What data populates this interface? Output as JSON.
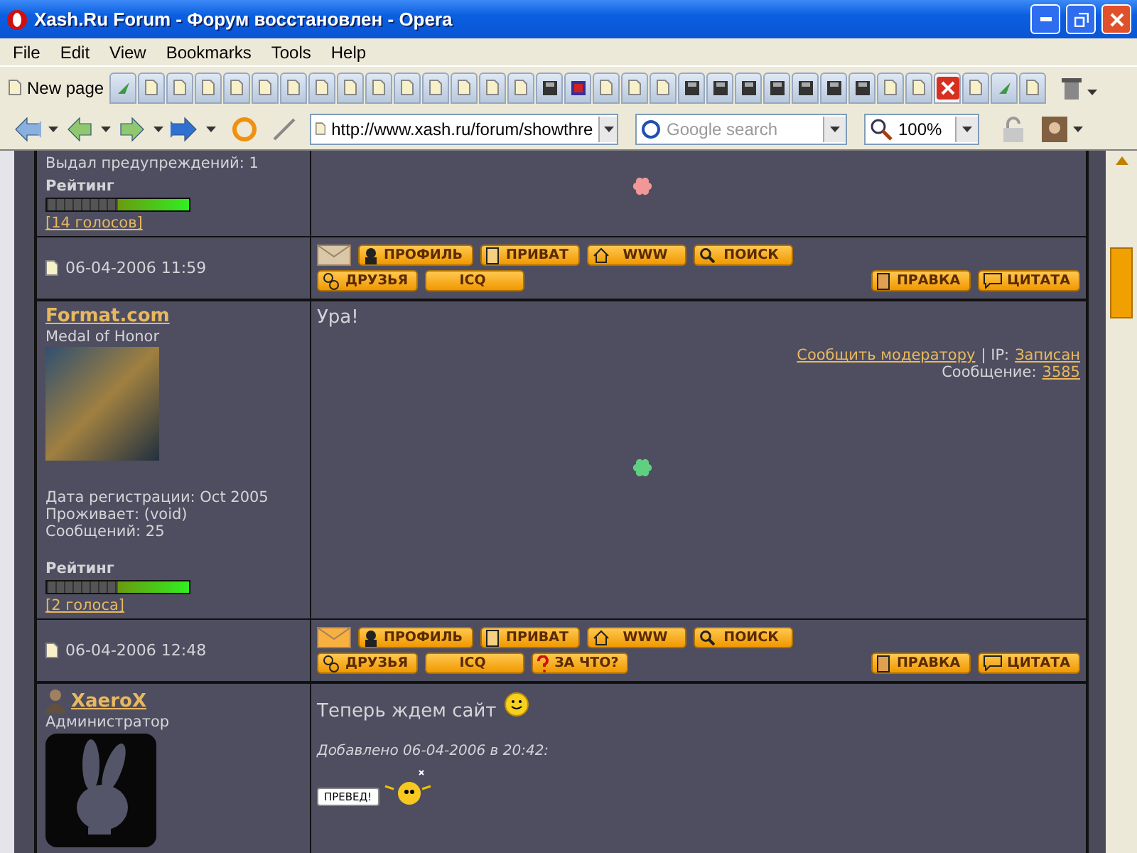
{
  "window": {
    "title": "Xash.Ru Forum - Форум восстановлен - Opera"
  },
  "menu": [
    "File",
    "Edit",
    "View",
    "Bookmarks",
    "Tools",
    "Help"
  ],
  "tab_bar": {
    "new_page": "New page",
    "tabs": [
      {
        "kind": "green",
        "selected": false
      },
      {
        "kind": "page",
        "selected": false
      },
      {
        "kind": "page",
        "selected": false
      },
      {
        "kind": "page",
        "selected": false
      },
      {
        "kind": "page",
        "selected": false
      },
      {
        "kind": "page",
        "selected": false
      },
      {
        "kind": "page",
        "selected": false
      },
      {
        "kind": "page",
        "selected": false
      },
      {
        "kind": "page",
        "selected": false
      },
      {
        "kind": "page",
        "selected": false
      },
      {
        "kind": "page",
        "selected": false
      },
      {
        "kind": "page",
        "selected": false
      },
      {
        "kind": "page",
        "selected": false
      },
      {
        "kind": "page",
        "selected": false
      },
      {
        "kind": "page",
        "selected": false
      },
      {
        "kind": "dark",
        "selected": false
      },
      {
        "kind": "red",
        "selected": false
      },
      {
        "kind": "page",
        "selected": false
      },
      {
        "kind": "page",
        "selected": false
      },
      {
        "kind": "page",
        "selected": false
      },
      {
        "kind": "dark",
        "selected": false
      },
      {
        "kind": "dark",
        "selected": false
      },
      {
        "kind": "dark",
        "selected": false
      },
      {
        "kind": "dark",
        "selected": false
      },
      {
        "kind": "dark",
        "selected": false
      },
      {
        "kind": "dark",
        "selected": false
      },
      {
        "kind": "dark",
        "selected": false
      },
      {
        "kind": "page",
        "selected": false
      },
      {
        "kind": "page",
        "selected": false
      },
      {
        "kind": "close",
        "selected": true
      },
      {
        "kind": "page",
        "selected": false
      },
      {
        "kind": "green",
        "selected": false
      },
      {
        "kind": "page",
        "selected": false
      }
    ]
  },
  "address_bar": {
    "url": "http://www.xash.ru/forum/showthre",
    "search_placeholder": "Google search",
    "zoom": "100%"
  },
  "posts": [
    {
      "user": {
        "lines": [
          "Выдал предупреждений: 1"
        ],
        "rating_label": "Рейтинг",
        "rating": {
          "level": 0.5
        },
        "votes": "[14 голосов]"
      },
      "body": {
        "flower": {
          "color": "#f09898"
        }
      },
      "footer": {
        "date": "06-04-2006 11:59",
        "envelope_new": false,
        "top_buttons": [
          {
            "kind": "profile",
            "label": "ПРОФИЛЬ"
          },
          {
            "kind": "private",
            "label": "ПРИВАТ"
          },
          {
            "kind": "home",
            "label": "WWW"
          },
          {
            "kind": "search",
            "label": "ПОИСК"
          }
        ],
        "left_buttons": [
          {
            "kind": "friends",
            "label": "ДРУЗЬЯ"
          },
          {
            "kind": "plain",
            "label": "ICQ"
          }
        ],
        "right_buttons": [
          {
            "kind": "edit",
            "label": "ПРАВКА"
          },
          {
            "kind": "quote",
            "label": "ЦИТАТА"
          }
        ]
      }
    },
    {
      "user": {
        "name": "Format.com",
        "rank": "Medal of Honor",
        "avatar": {
          "kind": "photo"
        },
        "lines": [
          "Дата регистрации: Oct 2005",
          "Проживает: (void)",
          "Сообщений: 25"
        ],
        "rating_label": "Рейтинг",
        "rating": {
          "level": 0.5
        },
        "votes": "[2 голоса]"
      },
      "body": {
        "text": "Ура!",
        "report": "Сообщить модератору",
        "ip_label": "| IP:",
        "ip": "Записан",
        "message_label": "Сообщение:",
        "message": "3585",
        "flower": {
          "color": "#60d080"
        }
      },
      "footer": {
        "date": "06-04-2006 12:48",
        "envelope_new": true,
        "top_buttons": [
          {
            "kind": "profile",
            "label": "ПРОФИЛЬ"
          },
          {
            "kind": "private",
            "label": "ПРИВАТ"
          },
          {
            "kind": "home",
            "label": "WWW"
          },
          {
            "kind": "search",
            "label": "ПОИСК"
          }
        ],
        "left_buttons": [
          {
            "kind": "friends",
            "label": "ДРУЗЬЯ"
          },
          {
            "kind": "plain",
            "label": "ICQ"
          },
          {
            "kind": "question",
            "label": "ЗА ЧТО?"
          }
        ],
        "right_buttons": [
          {
            "kind": "edit",
            "label": "ПРАВКА"
          },
          {
            "kind": "quote",
            "label": "ЦИТАТА"
          }
        ]
      }
    },
    {
      "user": {
        "name": "XaeroX",
        "rank": "Администратор",
        "mini_avatar": true,
        "avatar": {
          "kind": "bunny"
        }
      },
      "body": {
        "text": "Теперь ждем сайт",
        "smiley": true,
        "added": "Добавлено 06-04-2006 в 20:42:",
        "bubble": "ПРЕВЕД!"
      }
    }
  ]
}
